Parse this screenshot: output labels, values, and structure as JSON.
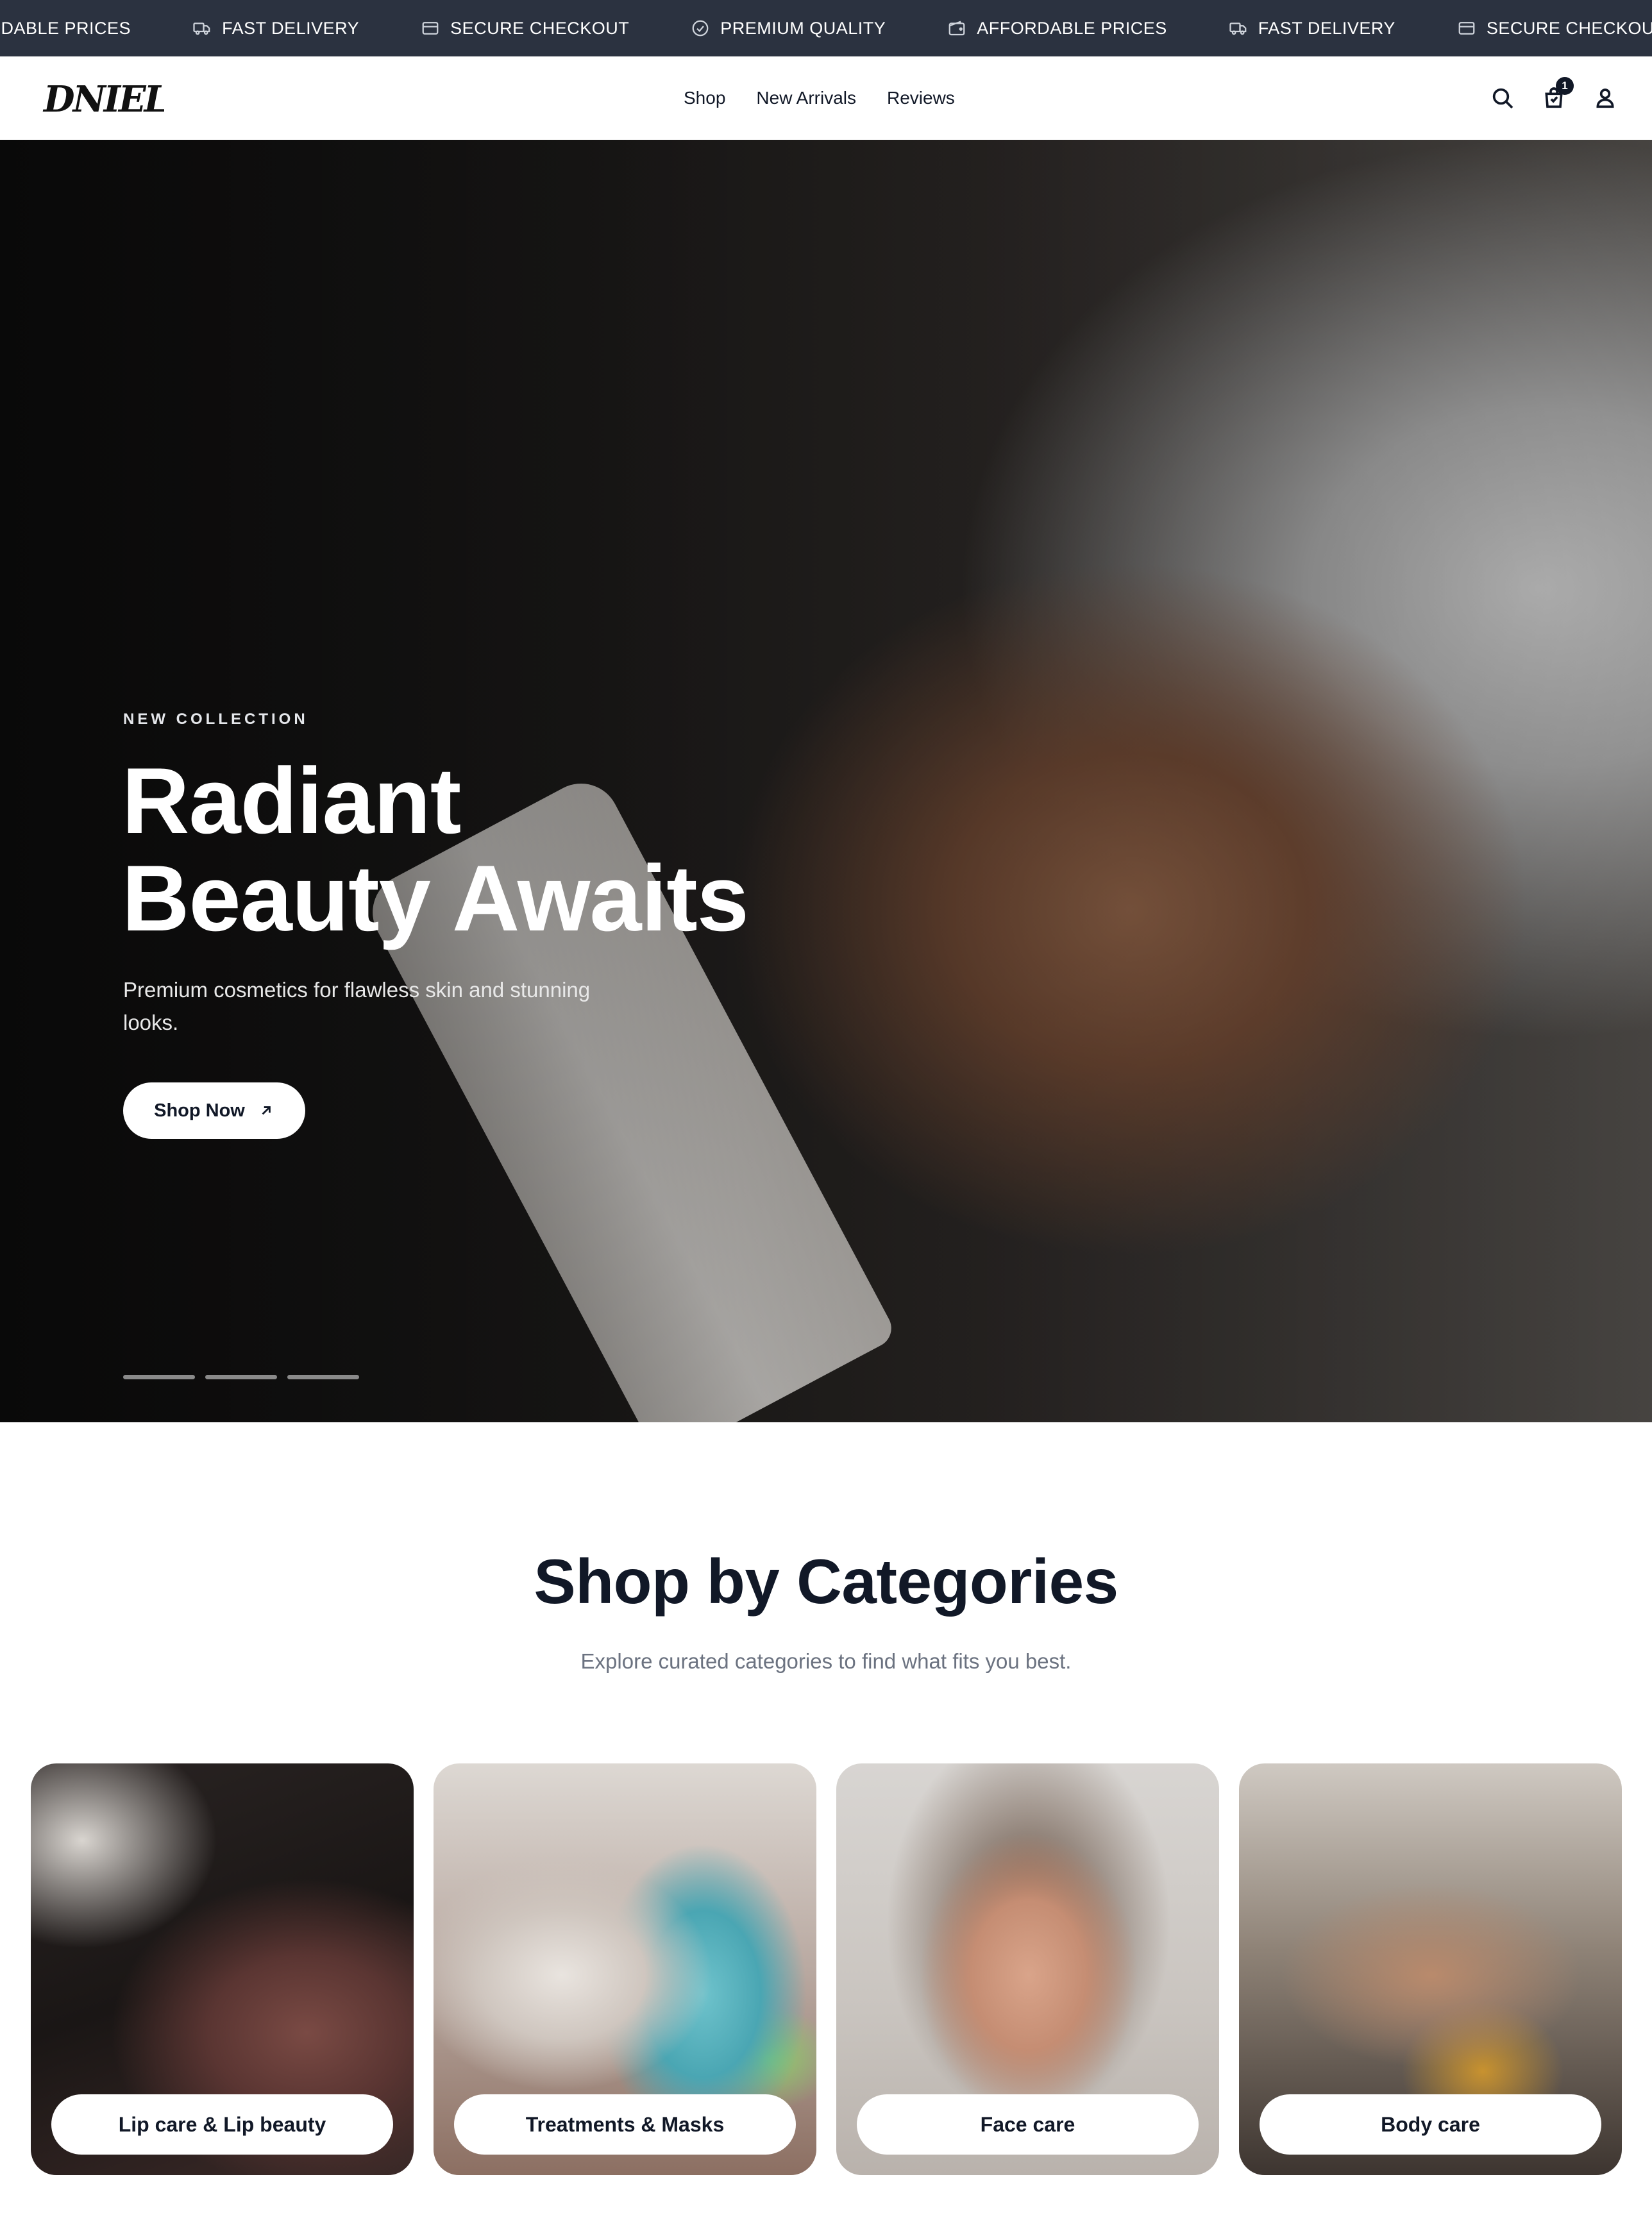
{
  "ticker": {
    "items": [
      {
        "label": "ORDABLE PRICES",
        "icon": "none"
      },
      {
        "label": "FAST DELIVERY",
        "icon": "truck-icon"
      },
      {
        "label": "SECURE CHECKOUT",
        "icon": "credit-card-icon"
      },
      {
        "label": "PREMIUM QUALITY",
        "icon": "check-circle-icon"
      },
      {
        "label": "AFFORDABLE PRICES",
        "icon": "wallet-icon"
      },
      {
        "label": "FAST DELIVERY",
        "icon": "truck-icon"
      },
      {
        "label": "SECURE CHECKOUT",
        "icon": "credit-card-icon"
      }
    ]
  },
  "header": {
    "logo_text": "DNIELLE",
    "nav": [
      "Shop",
      "New Arrivals",
      "Reviews"
    ],
    "cart_count": "1",
    "icons": [
      "search-icon",
      "cart-icon",
      "user-icon"
    ]
  },
  "hero": {
    "eyebrow": "NEW COLLECTION",
    "title_line1": "Radiant",
    "title_line2": "Beauty Awaits",
    "subtitle": "Premium cosmetics for flawless skin and stunning looks.",
    "cta_label": "Shop Now",
    "slide_count": 3
  },
  "categories": {
    "title": "Shop by Categories",
    "subtitle": "Explore curated categories to find what fits you best.",
    "items": [
      {
        "label": "Lip care & Lip beauty"
      },
      {
        "label": "Treatments & Masks"
      },
      {
        "label": "Face care"
      },
      {
        "label": "Body care"
      }
    ]
  },
  "colors": {
    "ticker_bg": "#2b3240",
    "text_dark": "#111827",
    "muted": "#6b7280"
  }
}
